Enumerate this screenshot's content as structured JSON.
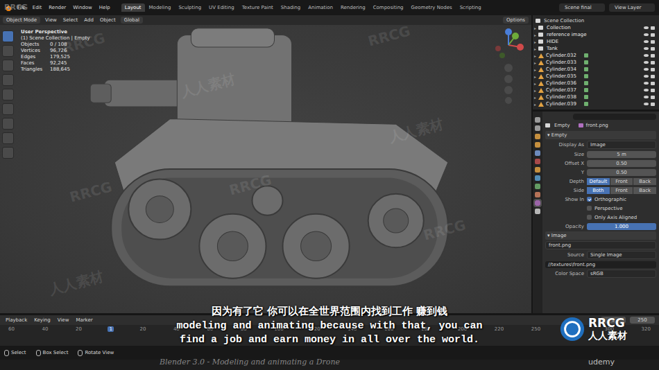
{
  "menubar": {
    "menus": [
      "File",
      "Edit",
      "Render",
      "Window",
      "Help"
    ],
    "workspaces": [
      {
        "label": "Layout",
        "selected": true
      },
      {
        "label": "Modeling",
        "selected": false
      },
      {
        "label": "Sculpting",
        "selected": false
      },
      {
        "label": "UV Editing",
        "selected": false
      },
      {
        "label": "Texture Paint",
        "selected": false
      },
      {
        "label": "Shading",
        "selected": false
      },
      {
        "label": "Animation",
        "selected": false
      },
      {
        "label": "Rendering",
        "selected": false
      },
      {
        "label": "Compositing",
        "selected": false
      },
      {
        "label": "Geometry Nodes",
        "selected": false
      },
      {
        "label": "Scripting",
        "selected": false
      }
    ],
    "scene": "Scene final",
    "view_layer": "View Layer"
  },
  "header": {
    "mode": "Object Mode",
    "menus": [
      "View",
      "Select",
      "Add",
      "Object"
    ],
    "orientation": "Global",
    "options": "Options"
  },
  "viewport": {
    "view_name": "User Perspective",
    "context": "(1) Scene Collection | Empty",
    "stats": [
      {
        "label": "Objects",
        "value": "0 / 108"
      },
      {
        "label": "Vertices",
        "value": "96,726"
      },
      {
        "label": "Edges",
        "value": "179,525"
      },
      {
        "label": "Faces",
        "value": "92,245"
      },
      {
        "label": "Triangles",
        "value": "188,645"
      }
    ]
  },
  "outliner": {
    "root": "Scene Collection",
    "items": [
      {
        "name": "Collection",
        "kind": "collection"
      },
      {
        "name": "reference image",
        "kind": "collection"
      },
      {
        "name": "HIDE",
        "kind": "collection"
      },
      {
        "name": "Tank",
        "kind": "collection"
      },
      {
        "name": "Cylinder.032",
        "kind": "mesh"
      },
      {
        "name": "Cylinder.033",
        "kind": "mesh"
      },
      {
        "name": "Cylinder.034",
        "kind": "mesh"
      },
      {
        "name": "Cylinder.035",
        "kind": "mesh"
      },
      {
        "name": "Cylinder.036",
        "kind": "mesh"
      },
      {
        "name": "Cylinder.037",
        "kind": "mesh"
      },
      {
        "name": "Cylinder.038",
        "kind": "mesh"
      },
      {
        "name": "Cylinder.039",
        "kind": "mesh"
      }
    ]
  },
  "properties": {
    "object": "Empty",
    "data": "front.png",
    "section": "Empty",
    "fields": [
      {
        "kind": "dropdown",
        "label": "Display As",
        "value": "Image"
      },
      {
        "kind": "number",
        "label": "Size",
        "value": "5 m"
      },
      {
        "kind": "number",
        "label": "Offset X",
        "value": "0.50"
      },
      {
        "kind": "number",
        "label": "Y",
        "value": "0.50"
      },
      {
        "kind": "segmented",
        "label": "Depth",
        "options": [
          {
            "label": "Default",
            "selected": true
          },
          {
            "label": "Front",
            "selected": false
          },
          {
            "label": "Back",
            "selected": false
          }
        ]
      },
      {
        "kind": "segmented",
        "label": "Side",
        "options": [
          {
            "label": "Both",
            "selected": true
          },
          {
            "label": "Front",
            "selected": false
          },
          {
            "label": "Back",
            "selected": false
          }
        ]
      },
      {
        "kind": "checkbox",
        "label": "Show In",
        "text": "Orthographic",
        "checked": true
      },
      {
        "kind": "checkbox",
        "label": "",
        "text": "Perspective",
        "checked": false
      },
      {
        "kind": "checkbox",
        "label": "",
        "text": "Only Axis Aligned",
        "checked": false
      },
      {
        "kind": "slider",
        "label": "Opacity",
        "value": "1.000",
        "level": 1
      }
    ],
    "image_section": "Image",
    "image_name": "front.png",
    "image_fields": [
      {
        "label": "Source",
        "value": "Single Image"
      }
    ],
    "filepath": "//textures\\front.png",
    "color_space_label": "Color Space",
    "color_space": "sRGB"
  },
  "timeline": {
    "menus": [
      "Playback",
      "Keying",
      "View",
      "Marker"
    ],
    "start": "1",
    "end": "250",
    "ticks": [
      {
        "label": "60",
        "selected": false
      },
      {
        "label": "40",
        "selected": false
      },
      {
        "label": "20",
        "selected": false
      },
      {
        "label": "1",
        "selected": true
      },
      {
        "label": "20",
        "selected": false
      },
      {
        "label": "40",
        "selected": false
      },
      {
        "label": "60",
        "selected": false
      },
      {
        "label": "80",
        "selected": false
      },
      {
        "label": "100",
        "selected": false
      },
      {
        "label": "120",
        "selected": false
      },
      {
        "label": "140",
        "selected": false
      },
      {
        "label": "160",
        "selected": false
      },
      {
        "label": "180",
        "selected": false
      },
      {
        "label": "200",
        "selected": false
      },
      {
        "label": "220",
        "selected": false
      },
      {
        "label": "250",
        "selected": false
      },
      {
        "label": "280",
        "selected": false
      },
      {
        "label": "300",
        "selected": false
      },
      {
        "label": "320",
        "selected": false
      }
    ]
  },
  "status_bar": [
    "Select",
    "Box Select",
    "Rotate View"
  ],
  "subtitles": {
    "zh": "因为有了它 你可以在全世界范围内找到工作 赚到钱",
    "en": [
      "modeling and animating because with that, you can",
      "find a job and earn money in all over the world."
    ]
  },
  "watermarks": {
    "corner": "RRCG",
    "course": "Blender 3.0 - Modeling and animating a Drone",
    "platform": "udemy",
    "brand": "RRCG",
    "brand_cn": "人人素材",
    "tiles": [
      "RRCG",
      "人人素材",
      "RRCG",
      "人人素材",
      "RRCG",
      "RRCG",
      "人人素材",
      "RRCG"
    ]
  }
}
